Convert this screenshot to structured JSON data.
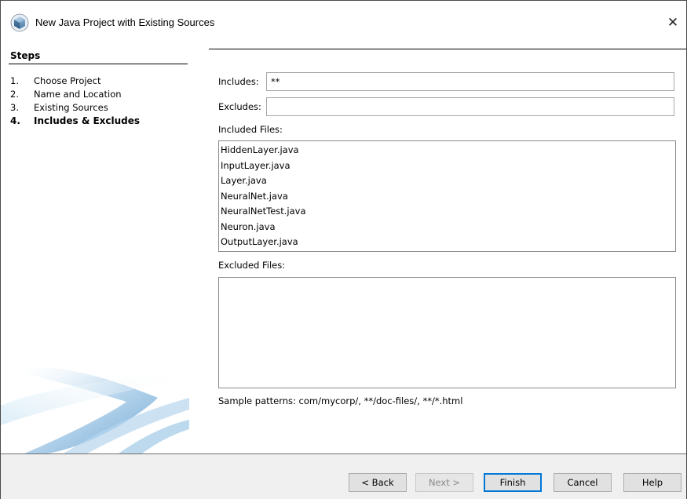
{
  "window": {
    "title": "New Java Project with Existing Sources",
    "close_glyph": "✕"
  },
  "steps": {
    "title": "Steps",
    "items": [
      {
        "num": "1.",
        "label": "Choose Project"
      },
      {
        "num": "2.",
        "label": "Name and Location"
      },
      {
        "num": "3.",
        "label": "Existing Sources"
      },
      {
        "num": "4.",
        "label": "Includes & Excludes"
      }
    ],
    "current_index": 3
  },
  "form": {
    "includes_label": "Includes:",
    "includes_value": "**",
    "excludes_label": "Excludes:",
    "excludes_value": "",
    "included_files_label": "Included Files:",
    "included_files": [
      "HiddenLayer.java",
      "InputLayer.java",
      "Layer.java",
      "NeuralNet.java",
      "NeuralNetTest.java",
      "Neuron.java",
      "OutputLayer.java"
    ],
    "excluded_files_label": "Excluded Files:",
    "excluded_files": [],
    "sample_patterns": "Sample patterns: com/mycorp/, **/doc-files/, **/*.html"
  },
  "buttons": {
    "back": "< Back",
    "next": "Next >",
    "finish": "Finish",
    "cancel": "Cancel",
    "help": "Help"
  },
  "icons": {
    "window_icon": "java-project-cube-icon",
    "close_icon": "close-icon"
  },
  "colors": {
    "accent": "#0078d7",
    "button_bar": "#f0f0f0",
    "swoosh": "#6fa8d6"
  }
}
